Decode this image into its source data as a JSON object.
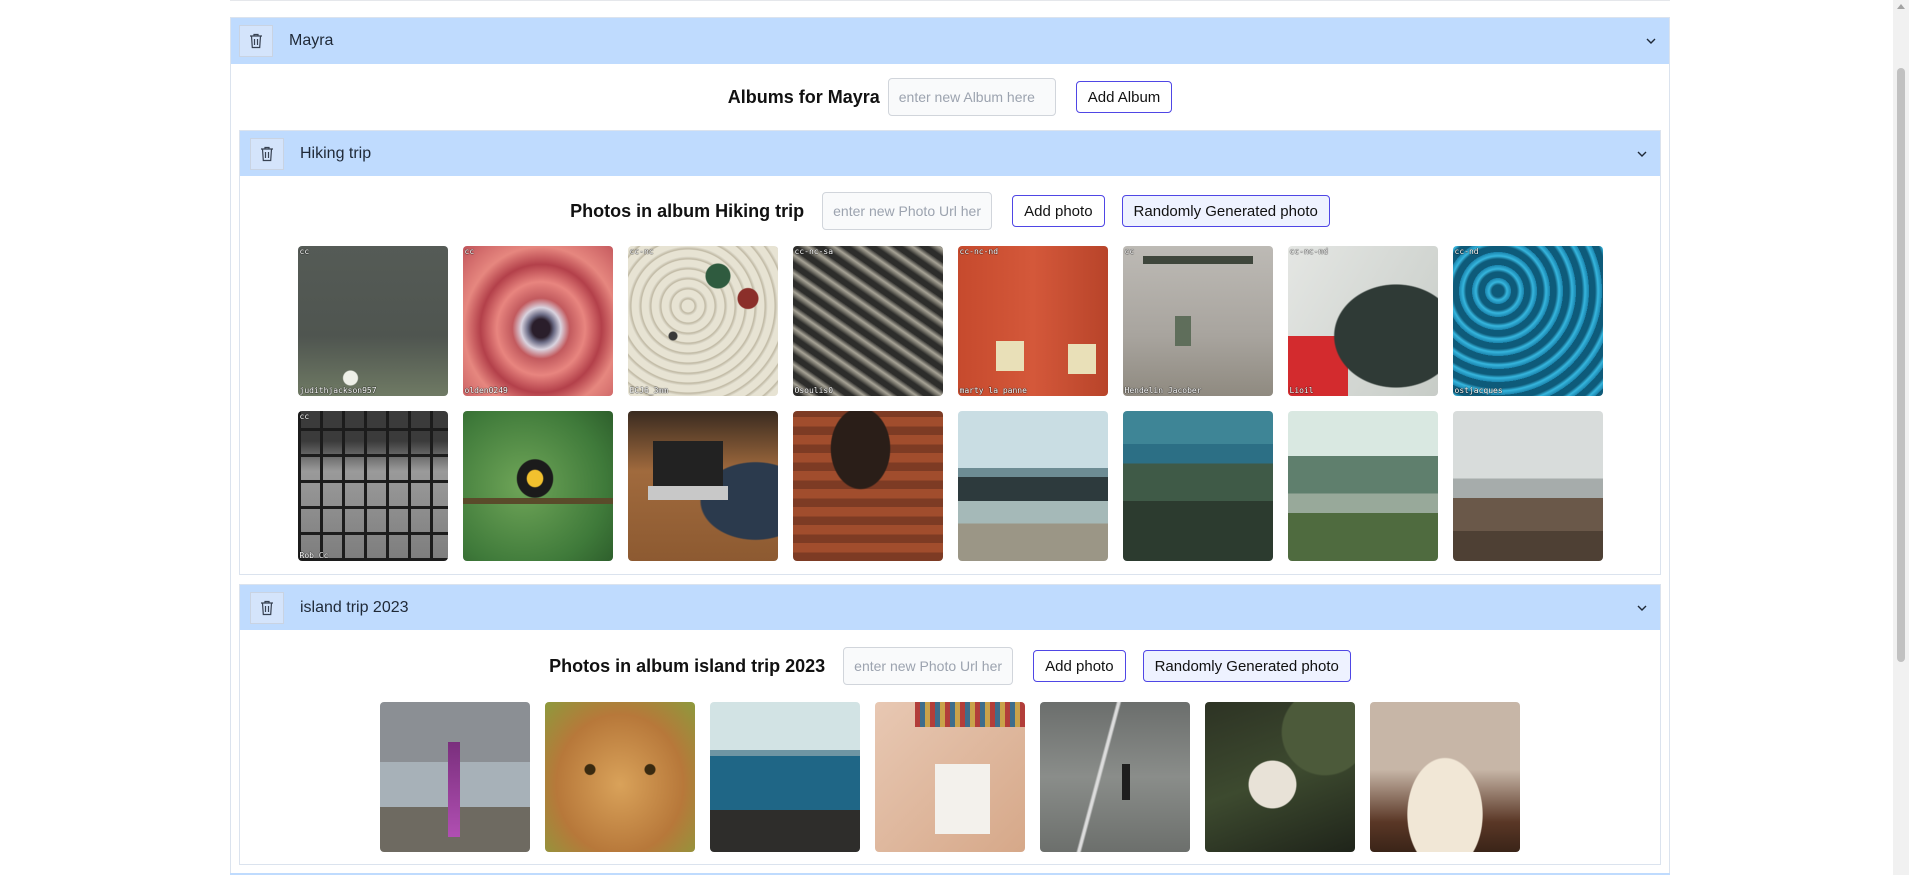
{
  "user": {
    "name": "Mayra",
    "albums_heading": "Albums for Mayra",
    "album_input_placeholder": "enter new Album here",
    "add_album_label": "Add Album"
  },
  "albums": [
    {
      "title": "Hiking trip",
      "photos_heading": "Photos in album Hiking trip",
      "photo_input_placeholder": "enter new Photo Url here",
      "add_photo_label": "Add photo",
      "random_photo_label": "Randomly Generated photo",
      "photos": [
        {
          "license": "cc",
          "credit": "judithjackson957"
        },
        {
          "license": "cc",
          "credit": "olden0249"
        },
        {
          "license": "cc-nc",
          "credit": "ECJ6_3mm"
        },
        {
          "license": "cc-nc-sa",
          "credit": "Osoulis0"
        },
        {
          "license": "cc-nc-nd",
          "credit": "marty la panne"
        },
        {
          "license": "cc",
          "credit": "Hendelin Jacober"
        },
        {
          "license": "cc-nc-nd",
          "credit": "Lioil"
        },
        {
          "license": "cc-nd",
          "credit": "ostjacques"
        },
        {
          "license": "cc",
          "credit": "Rob Cc"
        },
        {
          "license": "",
          "credit": ""
        },
        {
          "license": "",
          "credit": ""
        },
        {
          "license": "",
          "credit": ""
        },
        {
          "license": "",
          "credit": ""
        },
        {
          "license": "",
          "credit": ""
        },
        {
          "license": "",
          "credit": ""
        },
        {
          "license": "",
          "credit": ""
        }
      ]
    },
    {
      "title": "island trip 2023",
      "photos_heading": "Photos in album island trip 2023",
      "photo_input_placeholder": "enter new Photo Url here",
      "add_photo_label": "Add photo",
      "random_photo_label": "Randomly Generated photo"
    }
  ],
  "icons": {
    "delete": "trash-icon",
    "expand": "chevron-down-icon"
  },
  "colors": {
    "header_bg": "#bfdbfe",
    "button_border": "#4f46e5"
  }
}
